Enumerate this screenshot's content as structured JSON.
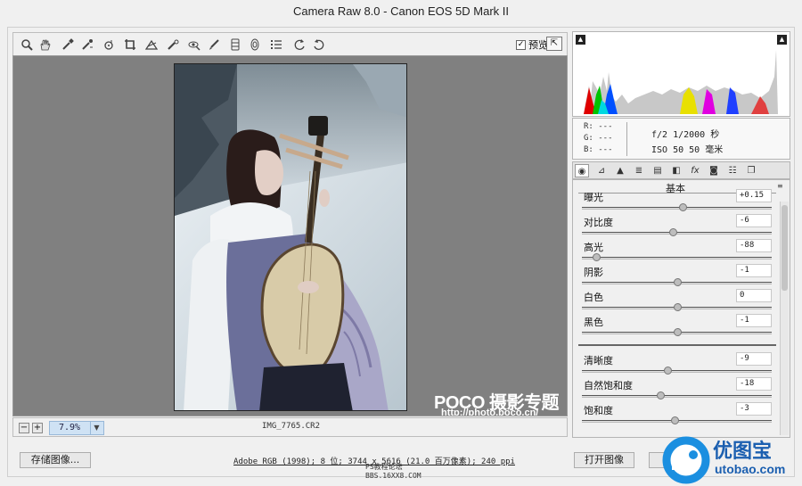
{
  "window": {
    "title": "Camera Raw 8.0 -  Canon EOS 5D Mark II"
  },
  "toolbar": {
    "tools": [
      "zoom-icon",
      "hand-icon",
      "white-balance-icon",
      "color-sampler-icon",
      "target-adjust-icon",
      "crop-icon",
      "straighten-icon",
      "spot-removal-icon",
      "red-eye-icon",
      "adjustment-brush-icon",
      "graduated-filter-icon",
      "radial-filter-icon",
      "preferences-icon",
      "rotate-ccw-icon",
      "rotate-cw-icon"
    ],
    "preview_label": "预览",
    "preview_checked": true
  },
  "image": {
    "watermark_brand": "POCO 摄影专题",
    "watermark_url": "http://photo.poco.cn/"
  },
  "status": {
    "zoom_out": "−",
    "zoom_in": "+",
    "zoom_level": "7.9%",
    "filename": "IMG_7765.CR2"
  },
  "info": {
    "r": "R:  ---",
    "g": "G:  ---",
    "b": "B:  ---",
    "aperture_shutter": "f/2   1/2000 秒",
    "iso_focal": "ISO 50   50 毫米"
  },
  "panel": {
    "title": "基本",
    "menu_icon": "≡",
    "tabs": [
      "basic-icon",
      "tone-curve-icon",
      "detail-icon",
      "hsl-icon",
      "split-toning-icon",
      "lens-icon",
      "effects-icon",
      "camera-calibration-icon",
      "presets-icon",
      "snapshots-icon"
    ],
    "sliders": [
      {
        "label": "曝光",
        "value": "+0.15",
        "pos": 0.53
      },
      {
        "label": "对比度",
        "value": "-6",
        "pos": 0.48
      },
      {
        "label": "高光",
        "value": "-88",
        "pos": 0.06
      },
      {
        "label": "阴影",
        "value": "-1",
        "pos": 0.5
      },
      {
        "label": "白色",
        "value": "0",
        "pos": 0.5
      },
      {
        "label": "黑色",
        "value": "-1",
        "pos": 0.5
      }
    ],
    "presence": [
      {
        "label": "清晰度",
        "value": "-9",
        "pos": 0.45
      },
      {
        "label": "自然饱和度",
        "value": "-18",
        "pos": 0.41
      },
      {
        "label": "饱和度",
        "value": "-3",
        "pos": 0.49
      }
    ]
  },
  "footer": {
    "save_label": "存储图像...",
    "workflow_link": "Adobe RGB (1998); 8 位; 3744 x 5616 (21.0 百万像素); 240 ppi",
    "open_label": "打开图像",
    "bbs_line1": "PS教程论坛",
    "bbs_line2": "BBS.16XX8.COM"
  },
  "brand": {
    "name": "优图宝",
    "url": "utobao.com"
  }
}
